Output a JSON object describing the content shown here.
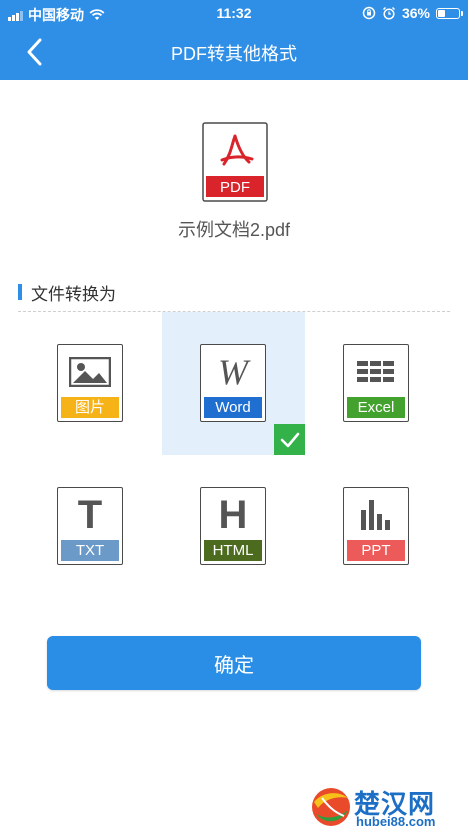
{
  "status": {
    "carrier": "中国移动",
    "time": "11:32",
    "battery": "36%",
    "battery_level": 0.36
  },
  "nav": {
    "title": "PDF转其他格式"
  },
  "file": {
    "type_label": "PDF",
    "name": "示例文档2.pdf"
  },
  "section": {
    "title": "文件转换为"
  },
  "formats": [
    {
      "label": "图片",
      "color": "#f5b318",
      "icon": "image-icon",
      "selected": false
    },
    {
      "label": "Word",
      "color": "#1f6fd1",
      "icon": "word-w-icon",
      "glyph": "W",
      "selected": true
    },
    {
      "label": "Excel",
      "color": "#43a22e",
      "icon": "grid-icon",
      "selected": false
    },
    {
      "label": "TXT",
      "color": "#6b9ac9",
      "icon": "txt-t-icon",
      "glyph": "T",
      "selected": false
    },
    {
      "label": "HTML",
      "color": "#4d6b1f",
      "icon": "html-h-icon",
      "glyph": "H",
      "selected": false
    },
    {
      "label": "PPT",
      "color": "#ec5a5a",
      "icon": "bar-chart-icon",
      "selected": false
    }
  ],
  "confirm_label": "确定",
  "watermark": {
    "brand": "楚汉网",
    "url": "hubei88.com"
  },
  "colors": {
    "accent": "#2f8fe6",
    "pdf_red": "#d9242b",
    "check_green": "#34b24a"
  }
}
